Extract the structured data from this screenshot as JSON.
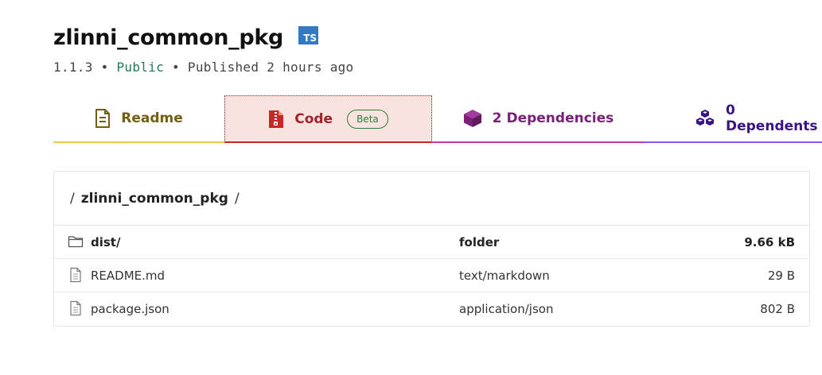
{
  "package": {
    "name": "zlinni_common_pkg",
    "ts_badge": "TS",
    "version": "1.1.3",
    "separator": " • ",
    "visibility": "Public",
    "published": "Published 2 hours ago"
  },
  "tabs": [
    {
      "label": "Readme",
      "icon": "readme-icon"
    },
    {
      "label": "Code",
      "icon": "code-zip-icon",
      "badge": "Beta"
    },
    {
      "label": "2 Dependencies",
      "icon": "box-icon"
    },
    {
      "label": "0 Dependents",
      "icon": "boxes-icon"
    }
  ],
  "browser": {
    "breadcrumb_sep": "/",
    "breadcrumb": "zlinni_common_pkg",
    "files": [
      {
        "name": "dist/",
        "type": "folder",
        "size": "9.66 kB",
        "icon": "folder-icon"
      },
      {
        "name": "README.md",
        "type": "text/markdown",
        "size": "29 B",
        "icon": "file-icon"
      },
      {
        "name": "package.json",
        "type": "application/json",
        "size": "802 B",
        "icon": "file-icon"
      }
    ]
  },
  "colors": {
    "typescript": "#3178c6",
    "public": "#237a59",
    "readme_tab": "#725f0f",
    "code_tab": "#a3212a",
    "deps_tab": "#7a2079",
    "dependents_tab": "#3a1480"
  }
}
